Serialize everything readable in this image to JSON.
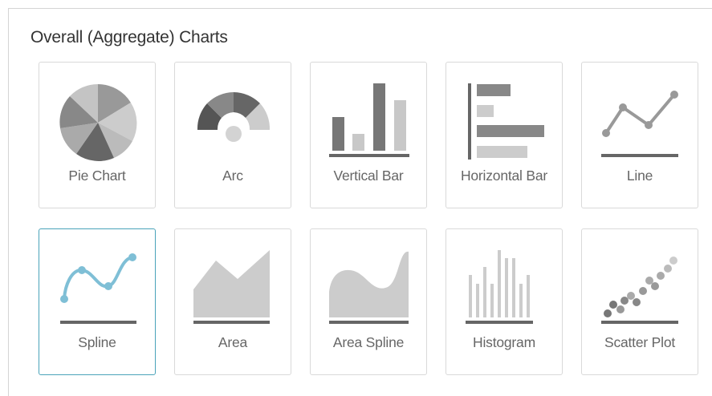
{
  "panel": {
    "title": "Overall (Aggregate) Charts"
  },
  "chart_types": [
    {
      "label": "Pie Chart",
      "icon": "pie-chart-icon"
    },
    {
      "label": "Arc",
      "icon": "arc-chart-icon"
    },
    {
      "label": "Vertical Bar",
      "icon": "vertical-bar-chart-icon"
    },
    {
      "label": "Horizontal Bar",
      "icon": "horizontal-bar-chart-icon"
    },
    {
      "label": "Line",
      "icon": "line-chart-icon"
    },
    {
      "label": "Spline",
      "icon": "spline-chart-icon",
      "selected": true
    },
    {
      "label": "Area",
      "icon": "area-chart-icon"
    },
    {
      "label": "Area Spline",
      "icon": "area-spline-chart-icon"
    },
    {
      "label": "Histogram",
      "icon": "histogram-chart-icon"
    },
    {
      "label": "Scatter Plot",
      "icon": "scatter-plot-icon"
    }
  ],
  "colors": {
    "selected_border": "#4aa3b9",
    "spline_accent": "#7fbfd6",
    "icon_dark": "#666666",
    "icon_mid": "#999999",
    "icon_light": "#cccccc",
    "label_text": "#666666"
  }
}
